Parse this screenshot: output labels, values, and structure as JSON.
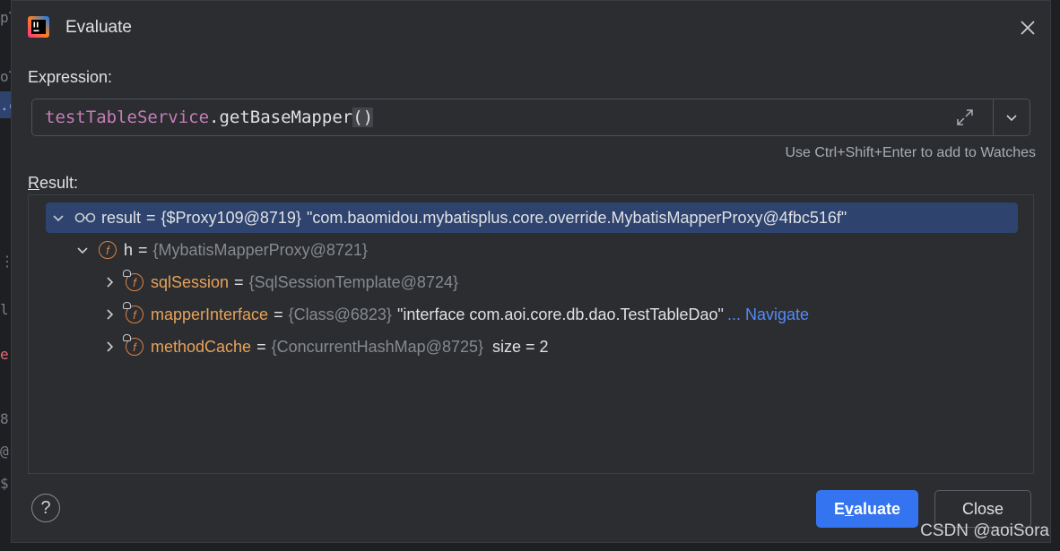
{
  "background": {
    "left_fragments": [
      "pT",
      "oT",
      ".c",
      "⋮",
      "l",
      "e",
      "8",
      "@",
      "$"
    ]
  },
  "dialog": {
    "title": "Evaluate",
    "expression_label": "Expression:",
    "expression": {
      "variable": "testTableService",
      "dot": ".",
      "method": "getBaseMapper",
      "parens": "()"
    },
    "hint": "Use Ctrl+Shift+Enter to add to Watches",
    "result_label": "Result:"
  },
  "tree": [
    {
      "name": "result",
      "eq": "=",
      "type": "{$Proxy109@8719}",
      "value": "\"com.baomidou.mybatisplus.core.override.MybatisMapperProxy@4fbc516f\"",
      "selected": true
    },
    {
      "name": "h",
      "eq": "=",
      "type": "{MybatisMapperProxy@8721}"
    },
    {
      "name": "sqlSession",
      "eq": "=",
      "type": "{SqlSessionTemplate@8724}"
    },
    {
      "name": "mapperInterface",
      "eq": "=",
      "type": "{Class@6823}",
      "value": "\"interface com.aoi.core.db.dao.TestTableDao\"",
      "link": "... Navigate"
    },
    {
      "name": "methodCache",
      "eq": "=",
      "type": "{ConcurrentHashMap@8725}",
      "value": "size = 2"
    }
  ],
  "buttons": {
    "help": "?",
    "evaluate": "Evaluate",
    "close": "Close"
  },
  "watermark": "CSDN @aoiSora",
  "colors": {
    "accent": "#3574f0",
    "selection": "#2e436e",
    "field_icon": "#d7844a",
    "link": "#548af7"
  }
}
